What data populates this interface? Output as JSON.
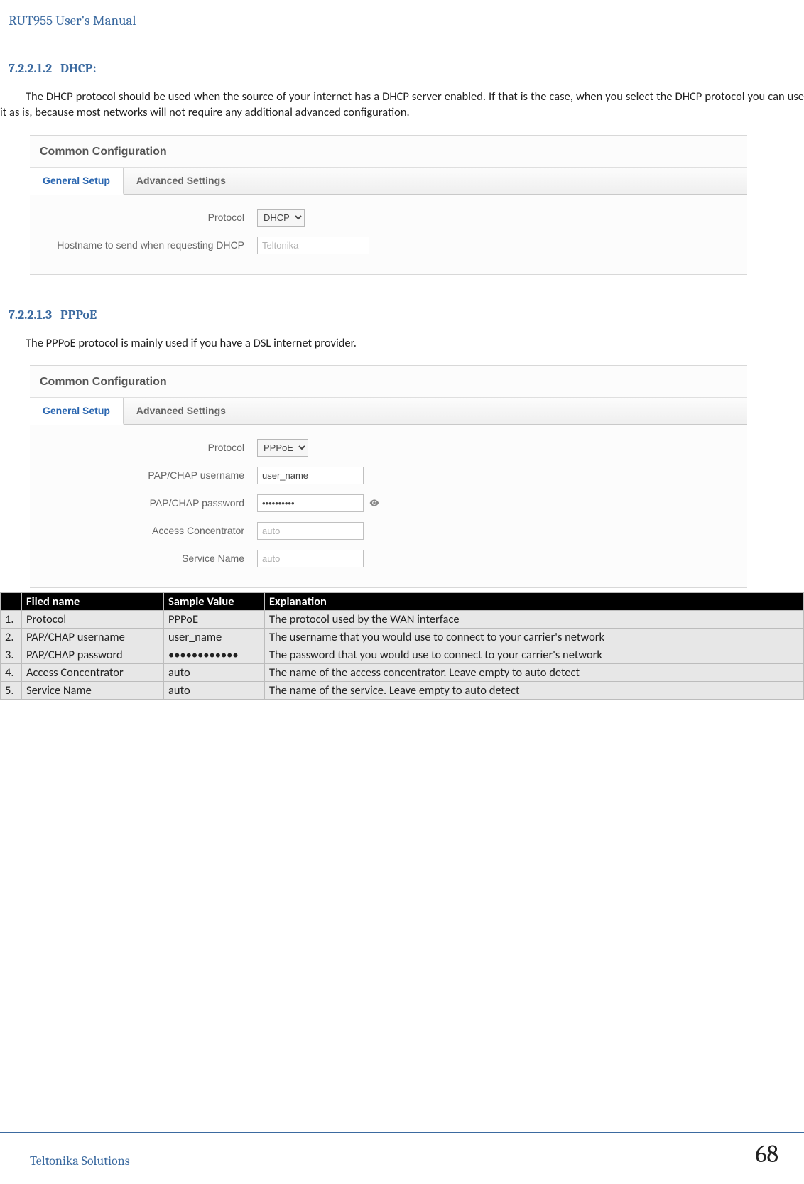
{
  "doc_header": "RUT955 User's Manual",
  "section_dhcp": {
    "num": "7.2.2.1.2",
    "title": "DHCP:",
    "paragraph": "The DHCP protocol should be used when the source of your internet has a DHCP server enabled. If that is the case, when you select the DHCP protocol you can use it as is, because most networks will not require any additional advanced configuration."
  },
  "panel_dhcp": {
    "heading": "Common Configuration",
    "tab_general": "General Setup",
    "tab_advanced": "Advanced Settings",
    "label_protocol": "Protocol",
    "value_protocol": "DHCP",
    "label_hostname": "Hostname to send when requesting DHCP",
    "placeholder_hostname": "Teltonika"
  },
  "section_pppoe": {
    "num": "7.2.2.1.3",
    "title": "PPPoE",
    "paragraph": "The PPPoE protocol is mainly used if you have a DSL internet provider."
  },
  "panel_pppoe": {
    "heading": "Common Configuration",
    "tab_general": "General Setup",
    "tab_advanced": "Advanced Settings",
    "label_protocol": "Protocol",
    "value_protocol": "PPPoE",
    "label_user": "PAP/CHAP username",
    "value_user": "user_name",
    "label_pass": "PAP/CHAP password",
    "value_pass": "••••••••••",
    "label_ac": "Access Concentrator",
    "placeholder_ac": "auto",
    "label_svc": "Service Name",
    "placeholder_svc": "auto"
  },
  "table": {
    "headers": {
      "fname": "Filed name",
      "sval": "Sample Value",
      "expl": "Explanation"
    },
    "rows": [
      {
        "n": "1.",
        "f": "Protocol",
        "s": "PPPoE",
        "e": "The protocol used by the WAN interface"
      },
      {
        "n": "2.",
        "f": "PAP/CHAP username",
        "s": "user_name",
        "e": "The username that you would use to connect to your carrier's network"
      },
      {
        "n": "3.",
        "f": "PAP/CHAP password",
        "s": "••••••••••••",
        "e": "The password that you would use to connect to your carrier's network"
      },
      {
        "n": "4.",
        "f": "Access Concentrator",
        "s": "auto",
        "e": "The name of the access concentrator. Leave empty to auto detect"
      },
      {
        "n": "5.",
        "f": "Service Name",
        "s": "auto",
        "e": "The name of the service. Leave empty to auto detect"
      }
    ]
  },
  "footer": {
    "left": "Teltonika Solutions",
    "page": "68"
  }
}
